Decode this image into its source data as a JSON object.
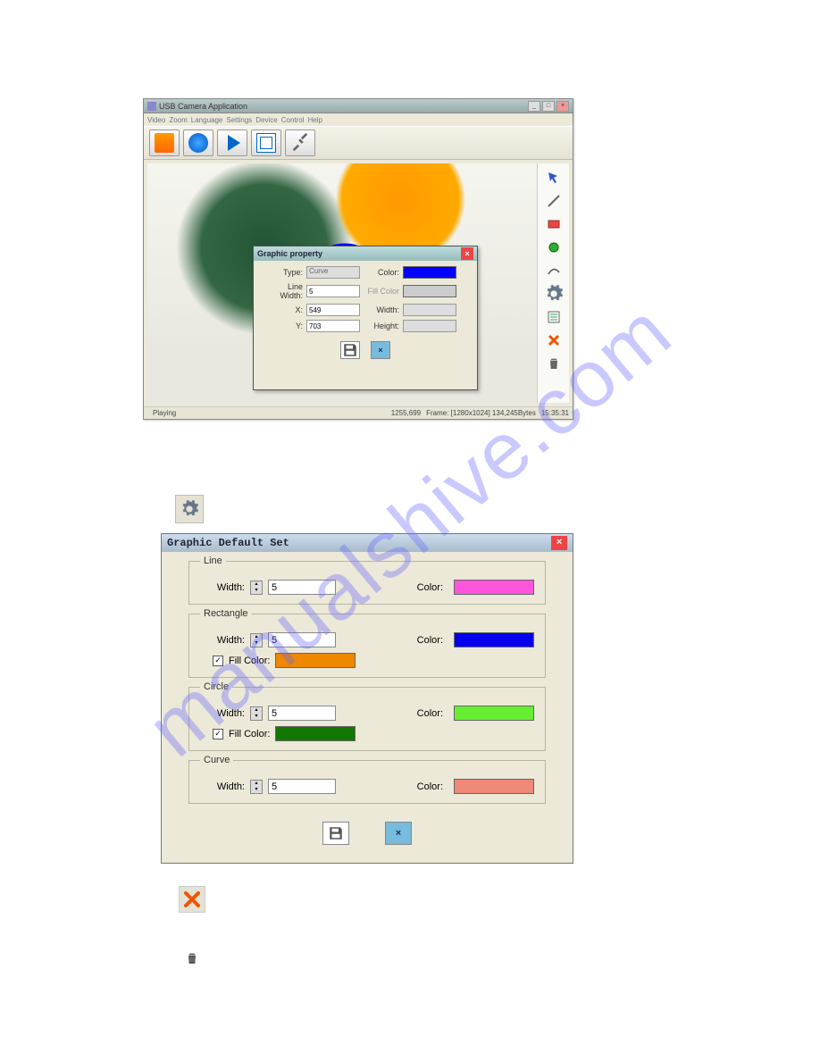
{
  "watermark": "manualshive.com",
  "app": {
    "title": "USB Camera Application",
    "menu": [
      "Video",
      "Zoom",
      "Language",
      "Settings",
      "Device",
      "Control",
      "Help"
    ],
    "status": {
      "left": "Playing",
      "coords": "1255,699",
      "frame": "Frame: [1280x1024] 134,245Bytes",
      "time": "15:35:31"
    }
  },
  "property_dialog": {
    "title": "Graphic property",
    "type_label": "Type:",
    "type_value": "Curve",
    "color_label": "Color:",
    "color_value": "#0000ff",
    "linewidth_label": "Line Width:",
    "linewidth_value": "5",
    "fillcolor_label": "Fill Color",
    "x_label": "X:",
    "x_value": "549",
    "width_label": "Width:",
    "y_label": "Y:",
    "y_value": "703",
    "height_label": "Height:"
  },
  "default_dialog": {
    "title": "Graphic Default Set",
    "line": {
      "legend": "Line",
      "width_label": "Width:",
      "width_value": "5",
      "color_label": "Color:",
      "color_value": "#ff55dd"
    },
    "rectangle": {
      "legend": "Rectangle",
      "width_label": "Width:",
      "width_value": "5",
      "color_label": "Color:",
      "color_value": "#0000ee",
      "fill_label": "Fill Color:",
      "fill_checked": true,
      "fill_value": "#ee8800"
    },
    "circle": {
      "legend": "Circle",
      "width_label": "Width:",
      "width_value": "5",
      "color_label": "Color:",
      "color_value": "#66ee33",
      "fill_label": "Fill Color:",
      "fill_checked": true,
      "fill_value": "#117700"
    },
    "curve": {
      "legend": "Curve",
      "width_label": "Width:",
      "width_value": "5",
      "color_label": "Color:",
      "color_value": "#ee8877"
    }
  }
}
